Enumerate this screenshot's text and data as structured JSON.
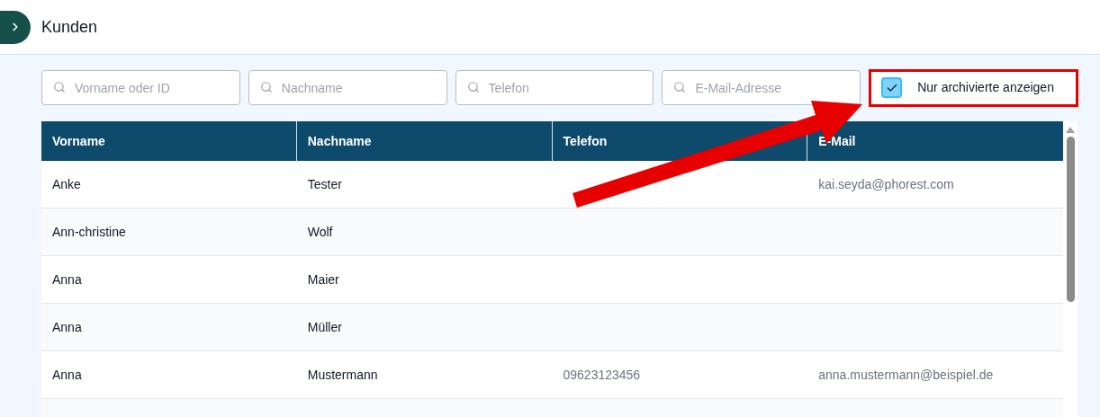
{
  "header": {
    "title": "Kunden"
  },
  "filters": [
    {
      "placeholder": "Vorname oder ID"
    },
    {
      "placeholder": "Nachname"
    },
    {
      "placeholder": "Telefon"
    },
    {
      "placeholder": "E-Mail-Adresse"
    }
  ],
  "archive_toggle": {
    "label": "Nur archivierte anzeigen",
    "checked": true,
    "highlighted": true
  },
  "table": {
    "columns": [
      "Vorname",
      "Nachname",
      "Telefon",
      "E-Mail"
    ],
    "rows": [
      {
        "vorname": "Anke",
        "nachname": "Tester",
        "email": "kai.seyda@phorest.com"
      },
      {
        "vorname": "Ann-christine",
        "nachname": "Wolf"
      },
      {
        "vorname": "Anna",
        "nachname": "Maier"
      },
      {
        "vorname": "Anna",
        "nachname": "Müller"
      },
      {
        "vorname": "Anna",
        "nachname": "Mustermann",
        "telefon": "09623123456",
        "email": "anna.mustermann@beispiel.de"
      }
    ]
  },
  "annotation": {
    "arrow": true
  }
}
